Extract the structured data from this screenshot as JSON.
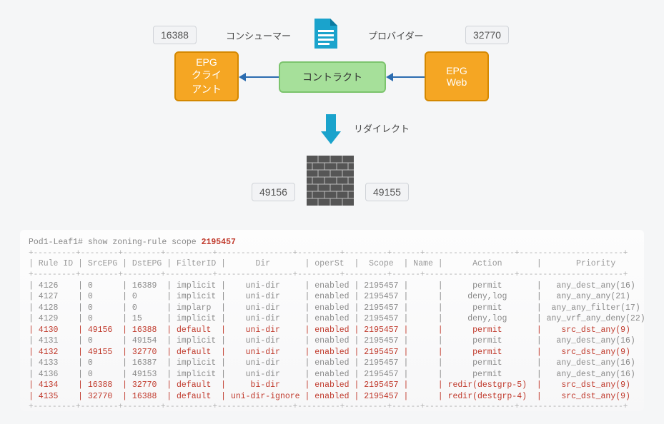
{
  "diagram": {
    "badge_left": "16388",
    "badge_right": "32770",
    "badge_fw_left": "49156",
    "badge_fw_right": "49155",
    "consumer_label": "コンシューマー",
    "provider_label": "プロバイダー",
    "epg_client": "EPG\nクライ\nアント",
    "epg_web": "EPG\nWeb",
    "contract": "コントラクト",
    "redirect_label": "リダイレクト"
  },
  "cli": {
    "prompt": "Pod1-Leaf1#",
    "command": "show zoning-rule scope",
    "scope_arg": "2195457",
    "headers": [
      "Rule ID",
      "SrcEPG",
      "DstEPG",
      "FilterID",
      "Dir",
      "operSt",
      "Scope",
      "Name",
      "Action",
      "Priority"
    ],
    "rows": [
      {
        "id": "4126",
        "src": "0",
        "dst": "16389",
        "fid": "implicit",
        "dir": "uni-dir",
        "oper": "enabled",
        "scope": "2195457",
        "name": "",
        "action": "permit",
        "prio": "any_dest_any(16)",
        "hl": false
      },
      {
        "id": "4127",
        "src": "0",
        "dst": "0",
        "fid": "implicit",
        "dir": "uni-dir",
        "oper": "enabled",
        "scope": "2195457",
        "name": "",
        "action": "deny,log",
        "prio": "any_any_any(21)",
        "hl": false
      },
      {
        "id": "4128",
        "src": "0",
        "dst": "0",
        "fid": "implarp",
        "dir": "uni-dir",
        "oper": "enabled",
        "scope": "2195457",
        "name": "",
        "action": "permit",
        "prio": "any_any_filter(17)",
        "hl": false
      },
      {
        "id": "4129",
        "src": "0",
        "dst": "15",
        "fid": "implicit",
        "dir": "uni-dir",
        "oper": "enabled",
        "scope": "2195457",
        "name": "",
        "action": "deny,log",
        "prio": "any_vrf_any_deny(22)",
        "hl": false
      },
      {
        "id": "4130",
        "src": "49156",
        "dst": "16388",
        "fid": "default",
        "dir": "uni-dir",
        "oper": "enabled",
        "scope": "2195457",
        "name": "",
        "action": "permit",
        "prio": "src_dst_any(9)",
        "hl": true
      },
      {
        "id": "4131",
        "src": "0",
        "dst": "49154",
        "fid": "implicit",
        "dir": "uni-dir",
        "oper": "enabled",
        "scope": "2195457",
        "name": "",
        "action": "permit",
        "prio": "any_dest_any(16)",
        "hl": false
      },
      {
        "id": "4132",
        "src": "49155",
        "dst": "32770",
        "fid": "default",
        "dir": "uni-dir",
        "oper": "enabled",
        "scope": "2195457",
        "name": "",
        "action": "permit",
        "prio": "src_dst_any(9)",
        "hl": true
      },
      {
        "id": "4133",
        "src": "0",
        "dst": "16387",
        "fid": "implicit",
        "dir": "uni-dir",
        "oper": "enabled",
        "scope": "2195457",
        "name": "",
        "action": "permit",
        "prio": "any_dest_any(16)",
        "hl": false
      },
      {
        "id": "4136",
        "src": "0",
        "dst": "49153",
        "fid": "implicit",
        "dir": "uni-dir",
        "oper": "enabled",
        "scope": "2195457",
        "name": "",
        "action": "permit",
        "prio": "any_dest_any(16)",
        "hl": false
      },
      {
        "id": "4134",
        "src": "16388",
        "dst": "32770",
        "fid": "default",
        "dir": "bi-dir",
        "oper": "enabled",
        "scope": "2195457",
        "name": "",
        "action": "redir(destgrp-5)",
        "prio": "src_dst_any(9)",
        "hl": true
      },
      {
        "id": "4135",
        "src": "32770",
        "dst": "16388",
        "fid": "default",
        "dir": "uni-dir-ignore",
        "oper": "enabled",
        "scope": "2195457",
        "name": "",
        "action": "redir(destgrp-4)",
        "prio": "src_dst_any(9)",
        "hl": true
      }
    ]
  },
  "chart_data": {
    "type": "table",
    "title": "show zoning-rule scope 2195457",
    "columns": [
      "Rule ID",
      "SrcEPG",
      "DstEPG",
      "FilterID",
      "Dir",
      "operSt",
      "Scope",
      "Name",
      "Action",
      "Priority"
    ],
    "rows": [
      [
        "4126",
        "0",
        "16389",
        "implicit",
        "uni-dir",
        "enabled",
        "2195457",
        "",
        "permit",
        "any_dest_any(16)"
      ],
      [
        "4127",
        "0",
        "0",
        "implicit",
        "uni-dir",
        "enabled",
        "2195457",
        "",
        "deny,log",
        "any_any_any(21)"
      ],
      [
        "4128",
        "0",
        "0",
        "implarp",
        "uni-dir",
        "enabled",
        "2195457",
        "",
        "permit",
        "any_any_filter(17)"
      ],
      [
        "4129",
        "0",
        "15",
        "implicit",
        "uni-dir",
        "enabled",
        "2195457",
        "",
        "deny,log",
        "any_vrf_any_deny(22)"
      ],
      [
        "4130",
        "49156",
        "16388",
        "default",
        "uni-dir",
        "enabled",
        "2195457",
        "",
        "permit",
        "src_dst_any(9)"
      ],
      [
        "4131",
        "0",
        "49154",
        "implicit",
        "uni-dir",
        "enabled",
        "2195457",
        "",
        "permit",
        "any_dest_any(16)"
      ],
      [
        "4132",
        "49155",
        "32770",
        "default",
        "uni-dir",
        "enabled",
        "2195457",
        "",
        "permit",
        "src_dst_any(9)"
      ],
      [
        "4133",
        "0",
        "16387",
        "implicit",
        "uni-dir",
        "enabled",
        "2195457",
        "",
        "permit",
        "any_dest_any(16)"
      ],
      [
        "4136",
        "0",
        "49153",
        "implicit",
        "uni-dir",
        "enabled",
        "2195457",
        "",
        "permit",
        "any_dest_any(16)"
      ],
      [
        "4134",
        "16388",
        "32770",
        "default",
        "bi-dir",
        "enabled",
        "2195457",
        "",
        "redir(destgrp-5)",
        "src_dst_any(9)"
      ],
      [
        "4135",
        "32770",
        "16388",
        "default",
        "uni-dir-ignore",
        "enabled",
        "2195457",
        "",
        "redir(destgrp-4)",
        "src_dst_any(9)"
      ]
    ]
  }
}
